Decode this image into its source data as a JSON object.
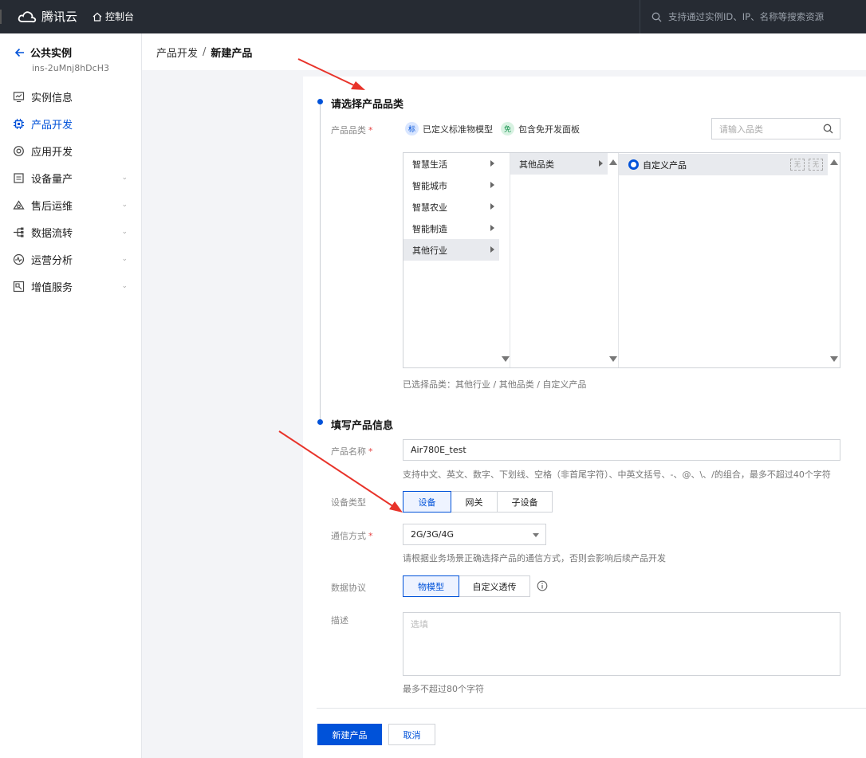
{
  "topbar": {
    "brand": "腾讯云",
    "console": "控制台",
    "search_placeholder": "支持通过实例ID、IP、名称等搜索资源"
  },
  "sidebar": {
    "instance_title": "公共实例",
    "instance_id": "ins-2uMnj8hDcH3",
    "items": [
      {
        "label": "实例信息",
        "icon": "monitor-icon",
        "active": false,
        "expandable": false
      },
      {
        "label": "产品开发",
        "icon": "chip-icon",
        "active": true,
        "expandable": false
      },
      {
        "label": "应用开发",
        "icon": "app-icon",
        "active": false,
        "expandable": false
      },
      {
        "label": "设备量产",
        "icon": "device-icon",
        "active": false,
        "expandable": true
      },
      {
        "label": "售后运维",
        "icon": "maintenance-icon",
        "active": false,
        "expandable": true
      },
      {
        "label": "数据流转",
        "icon": "flow-icon",
        "active": false,
        "expandable": true
      },
      {
        "label": "运营分析",
        "icon": "analytics-icon",
        "active": false,
        "expandable": true
      },
      {
        "label": "增值服务",
        "icon": "service-icon",
        "active": false,
        "expandable": true
      }
    ]
  },
  "breadcrumb": {
    "parent": "产品开发",
    "separator": "/",
    "current": "新建产品"
  },
  "category_section": {
    "title": "请选择产品品类",
    "field_label": "产品品类",
    "tag_standard": {
      "badge": "标",
      "label": "已定义标准物模型"
    },
    "tag_free": {
      "badge": "免",
      "label": "包含免开发面板"
    },
    "search_placeholder": "请输入品类",
    "column1": [
      "智慧生活",
      "智能城市",
      "智慧农业",
      "智能制造",
      "其他行业"
    ],
    "column1_selected": "其他行业",
    "column2": [
      "其他品类"
    ],
    "column3": [
      "自定义产品"
    ],
    "column3_icons": [
      "无",
      "无"
    ],
    "selected_path": "已选择品类：其他行业 / 其他品类 / 自定义产品"
  },
  "info_section": {
    "title": "填写产品信息",
    "name_label": "产品名称",
    "name_value": "Air780E_test",
    "name_hint": "支持中文、英文、数字、下划线、空格（非首尾字符）、中英文括号、-、@、\\、/的组合，最多不超过40个字符",
    "device_type_label": "设备类型",
    "device_types": [
      "设备",
      "网关",
      "子设备"
    ],
    "device_type_selected": "设备",
    "comm_label": "通信方式",
    "comm_value": "2G/3G/4G",
    "comm_hint": "请根据业务场景正确选择产品的通信方式，否则会影响后续产品开发",
    "protocol_label": "数据协议",
    "protocols": [
      "物模型",
      "自定义透传"
    ],
    "protocol_selected": "物模型",
    "desc_label": "描述",
    "desc_placeholder": "选填",
    "desc_hint": "最多不超过80个字符"
  },
  "actions": {
    "create": "新建产品",
    "cancel": "取消"
  },
  "colors": {
    "primary": "#0052d9",
    "annotation_arrow": "#e8332a",
    "required": "#e54545"
  }
}
